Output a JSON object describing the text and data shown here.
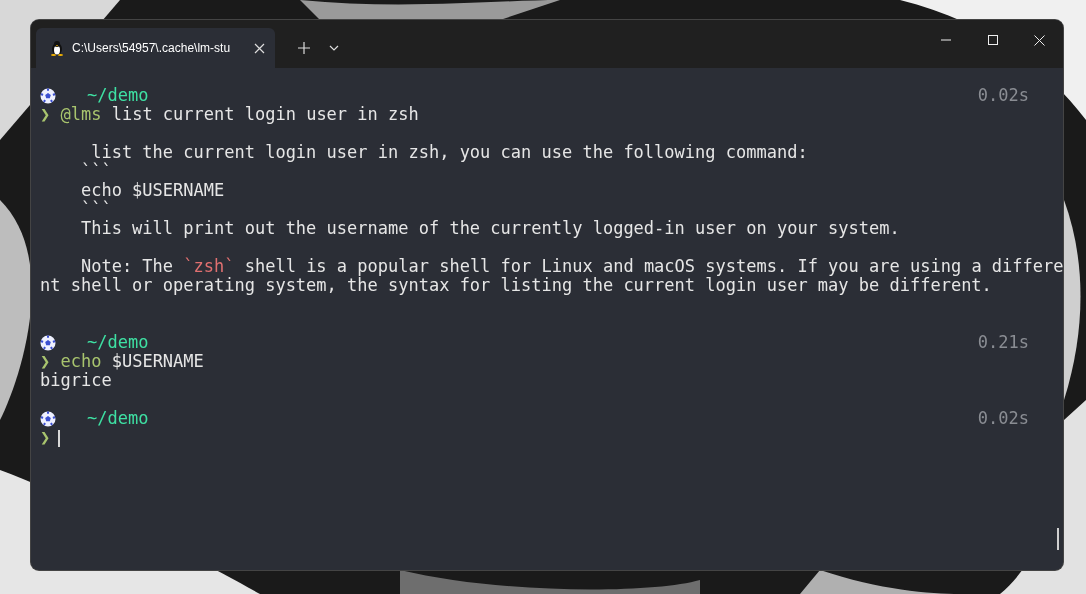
{
  "window": {
    "tab": {
      "title": "C:\\Users\\54957\\.cache\\lm-stu",
      "selected": true
    }
  },
  "terminal": {
    "blocks": [
      {
        "prompt": {
          "path": "~/demo",
          "duration": "0.02s"
        },
        "command": {
          "symbol": "❯",
          "segments": [
            {
              "text": "@lms",
              "kind": "alias"
            },
            {
              "text": " list current login user in zsh",
              "kind": "plain"
            }
          ]
        },
        "output": [
          {
            "kind": "blank"
          },
          {
            "kind": "text",
            "segments": [
              {
                "text": "     list the current login user in zsh, you can use the following command:",
                "kind": "plain"
              }
            ]
          },
          {
            "kind": "text",
            "segments": [
              {
                "text": "    ```",
                "kind": "plain"
              }
            ]
          },
          {
            "kind": "text",
            "segments": [
              {
                "text": "    echo $USERNAME",
                "kind": "plain"
              }
            ]
          },
          {
            "kind": "text",
            "segments": [
              {
                "text": "    ```",
                "kind": "plain"
              }
            ]
          },
          {
            "kind": "text",
            "segments": [
              {
                "text": "    This will print out the username of the currently logged-in user on your system.",
                "kind": "plain"
              }
            ]
          },
          {
            "kind": "blank"
          },
          {
            "kind": "text",
            "segments": [
              {
                "text": "    Note: The ",
                "kind": "plain"
              },
              {
                "text": "`zsh`",
                "kind": "code"
              },
              {
                "text": " shell is a popular shell for Linux and macOS systems. If you are using a differe",
                "kind": "plain"
              }
            ]
          },
          {
            "kind": "text",
            "segments": [
              {
                "text": "nt shell or operating system, the syntax for listing the current login user may be different.",
                "kind": "plain"
              }
            ]
          },
          {
            "kind": "blank"
          },
          {
            "kind": "blank"
          }
        ]
      },
      {
        "prompt": {
          "path": "~/demo",
          "duration": "0.21s"
        },
        "command": {
          "symbol": "❯",
          "segments": [
            {
              "text": "echo",
              "kind": "alias"
            },
            {
              "text": " $USERNAME",
              "kind": "plain"
            }
          ]
        },
        "output": [
          {
            "kind": "text",
            "segments": [
              {
                "text": "bigrice",
                "kind": "plain"
              }
            ]
          },
          {
            "kind": "blank"
          }
        ]
      },
      {
        "prompt": {
          "path": "~/demo",
          "duration": "0.02s"
        },
        "command": {
          "symbol": "❯",
          "cursor": true
        }
      }
    ]
  }
}
